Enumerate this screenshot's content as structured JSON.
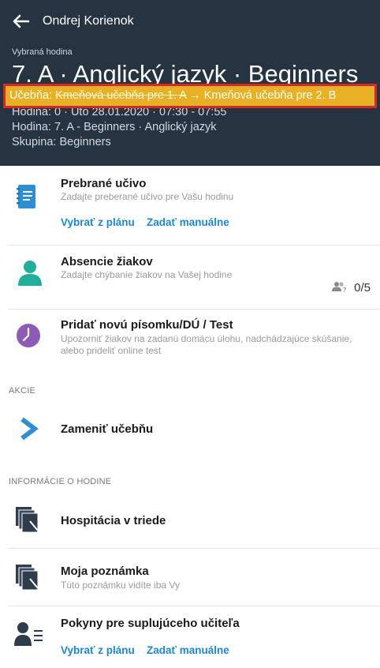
{
  "header": {
    "user_name": "Ondrej Korienok",
    "selected_label": "Vybraná hodina",
    "lesson_title": "7. A · Anglický jazyk · Beginners",
    "room_change": {
      "prefix": "Učebňa:",
      "old_room": "Kmeňová učebňa pre 1. A",
      "arrow": "→",
      "new_room": "Kmeňová učebňa pre 2. B"
    },
    "time_line": "Hodina: 0 · Uto 28.01.2020 · 07:30 - 07:55",
    "lesson_line": "Hodina: 7. A - Beginners · Anglický jazyk",
    "group_line": "Skupina: Beginners"
  },
  "items": {
    "topic": {
      "title": "Prebrané učivo",
      "subtitle": "Zadajte preberané učivo pre Vašu hodinu",
      "link_plan": "Vybrať z plánu",
      "link_manual": "Zadať manuálne"
    },
    "absence": {
      "title": "Absencie žiakov",
      "subtitle": "Zadajte chýbanie žiakov na Vašej hodine",
      "count": "0/5"
    },
    "test": {
      "title": "Pridať novú písomku/DÚ / Test",
      "subtitle": "Upozorniť žiakov na zadanú domácu úlohu, nadchádzajúce skúšanie, alebo prideliť online test"
    }
  },
  "sections": {
    "actions_label": "AKCIE",
    "info_label": "INFORMÁCIE O HODINE"
  },
  "actions": {
    "change_room": "Zameniť učebňu"
  },
  "info": {
    "inspection": {
      "title": "Hospitácia v triede"
    },
    "note": {
      "title": "Moja poznámka",
      "subtitle": "Túto poznámku vidíte iba Vy"
    },
    "substitute": {
      "title": "Pokyny pre suplujúceho učiteľa",
      "link_plan": "Vybrať z plánu",
      "link_manual": "Zadať manuálne"
    }
  },
  "colors": {
    "header_bg": "#263341",
    "highlight_bg": "#e8b124",
    "highlight_border": "#d8262b",
    "link": "#1a88d8",
    "icon_blue": "#2b8fd6",
    "icon_teal": "#1fb09a",
    "icon_purple": "#8e5ab8",
    "icon_dark": "#2e3c4c"
  },
  "icons": {
    "back": "arrow-left-icon",
    "topic": "notebook-icon",
    "absence": "person-icon",
    "test": "clock-icon",
    "change_room": "chevron-right-icon",
    "inspection": "documents-icon",
    "note": "documents-icon",
    "substitute": "person-list-icon",
    "counter": "people-question-icon"
  }
}
